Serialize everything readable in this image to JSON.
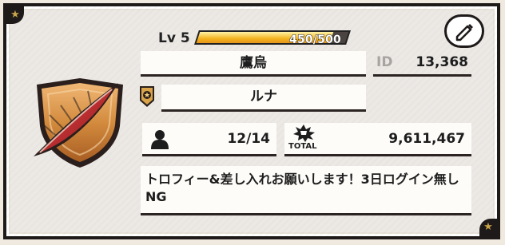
{
  "profile": {
    "level_label": "Lv 5",
    "xp_text": "450/500",
    "xp_fraction": 0.9,
    "name": "鷹烏",
    "id_label": "ID",
    "id_value": "13,368",
    "rank_name": "ルナ",
    "members": "12/14",
    "total_label": "TOTAL",
    "total_value": "9,611,467",
    "comment": "トロフィー&差し入れお願いします！3日ログイン無しNG"
  },
  "icons": {
    "emblem": "feather-shield-emblem-icon",
    "edit": "pencil-icon",
    "rank": "rank-badge-icon",
    "members": "person-icon",
    "total": "trophy-burst-icon",
    "corner": "star-icon"
  },
  "colors": {
    "xp_fill": "#f4b31e",
    "emblem_gold": "#d08b3c",
    "feather_red": "#b3242b",
    "frame_dark": "#1e1a19"
  }
}
